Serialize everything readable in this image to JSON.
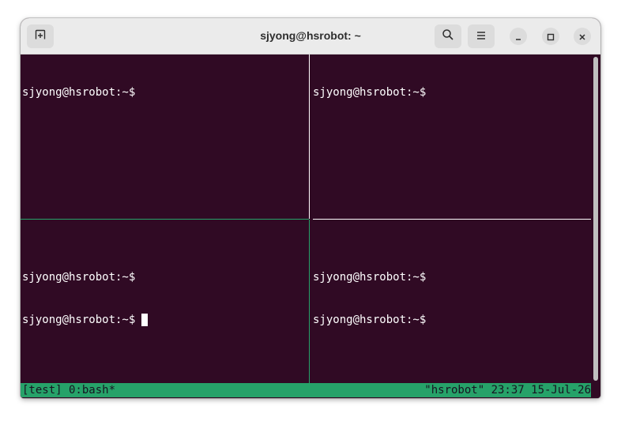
{
  "window": {
    "title": "sjyong@hsrobot: ~"
  },
  "icons": {
    "new_tab": "new-tab-icon",
    "search": "search-icon",
    "menu": "hamburger-menu-icon",
    "minimize": "minimize-icon",
    "maximize": "maximize-icon",
    "close": "close-icon"
  },
  "panes": [
    {
      "lines": [
        "sjyong@hsrobot:~$"
      ]
    },
    {
      "lines": [
        "sjyong@hsrobot:~$"
      ]
    },
    {
      "lines": [
        "sjyong@hsrobot:~$",
        "sjyong@hsrobot:~$"
      ]
    },
    {
      "lines": [
        "sjyong@hsrobot:~$",
        "sjyong@hsrobot:~$"
      ]
    }
  ],
  "status_bar": {
    "left": "[test] 0:bash*",
    "right": "\"hsrobot\" 23:37 15-Jul-26"
  },
  "colors": {
    "terminal_background": "#300a24",
    "terminal_text": "#ffffff",
    "status_bar": "#26a269",
    "active_pane_border": "#26a269",
    "inactive_pane_border": "#ffffff"
  }
}
